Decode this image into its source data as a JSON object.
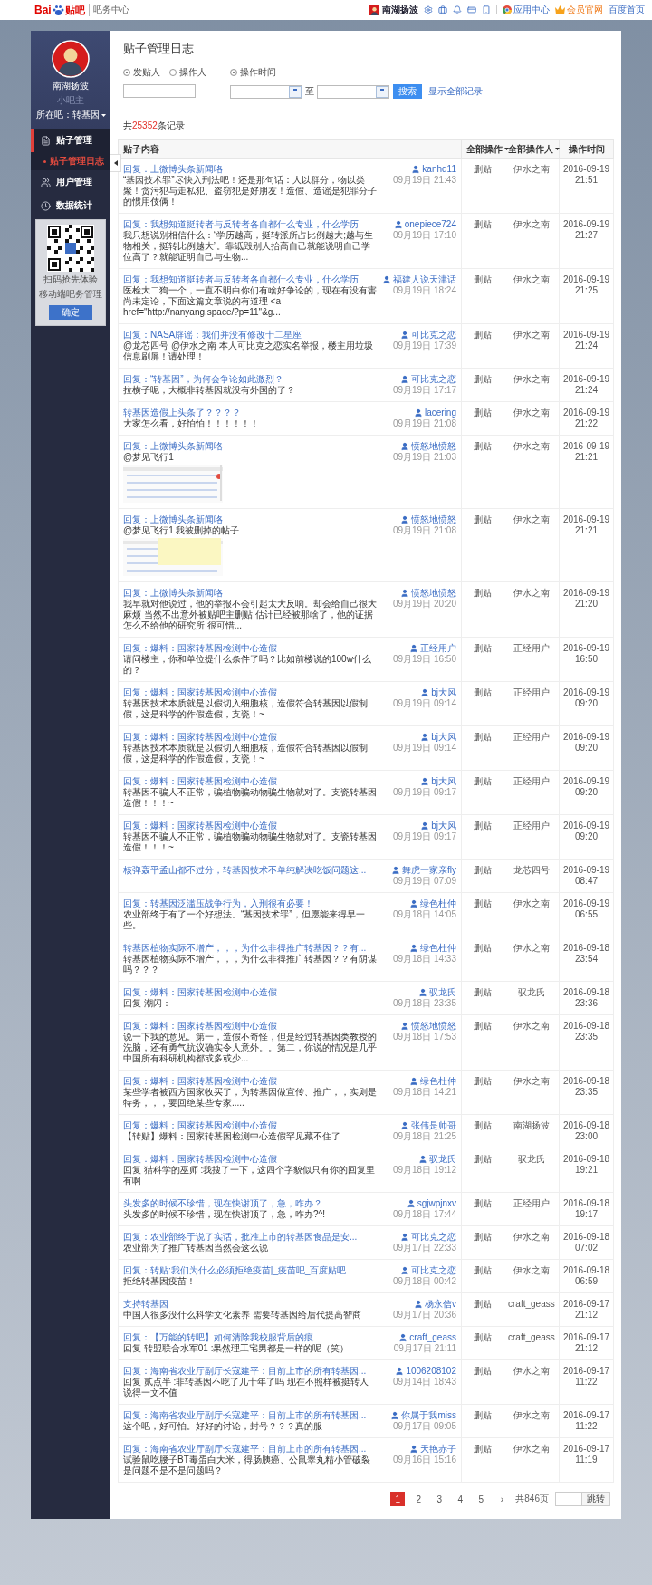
{
  "header": {
    "logo": {
      "latin": "Bai",
      "brand": "贴吧"
    },
    "product": "吧务中心",
    "user": "南湖扬波",
    "links": [
      {
        "label": "应用中心",
        "kind": "apps"
      },
      {
        "label": "会员官网",
        "kind": "vip"
      },
      {
        "label": "百度首页",
        "kind": "plain"
      }
    ]
  },
  "sidebar": {
    "profile": {
      "name": "南湖扬波",
      "role": "小吧主",
      "forum": "所在吧：转基因"
    },
    "menu": [
      {
        "label": "贴子管理",
        "kind": "posts",
        "selected": true,
        "children": [
          {
            "label": "贴子管理日志",
            "selected": true
          }
        ]
      },
      {
        "label": "用户管理",
        "kind": "users",
        "selected": false
      },
      {
        "label": "数据统计",
        "kind": "stats",
        "selected": false
      }
    ],
    "qr_popup": {
      "lines": [
        "扫码抢先体验",
        "移动端吧务管理"
      ],
      "button": "确定"
    }
  },
  "page": {
    "title": "贴子管理日志",
    "filters": {
      "by": [
        {
          "label": "发贴人",
          "selected": true
        },
        {
          "label": "操作人",
          "selected": false
        }
      ],
      "time": {
        "label": "操作时间",
        "selected": true
      },
      "separator": "至",
      "search_button": "搜索",
      "show_all": "显示全部记录"
    },
    "record_count": {
      "prefix": "共",
      "count": "25352",
      "suffix": "条记录"
    }
  },
  "table": {
    "columns": [
      {
        "label": "贴子内容",
        "dropdown": false
      },
      {
        "label": "全部操作",
        "dropdown": true
      },
      {
        "label": "全部操作人",
        "dropdown": true
      },
      {
        "label": "操作时间",
        "dropdown": false
      }
    ],
    "rows": [
      {
        "kind": "text",
        "title": "回复：上微博头条新闻咯",
        "body": "“基因技术罪”尽快入刑法吧！还是那句话：人以群分，物以类聚！贪污犯与走私犯、盗窃犯是好朋友！造假、造谣是犯罪分子的惯用伎俩！",
        "author": "kanhd11",
        "posted": "09月19日 21:43",
        "action": "删贴",
        "operator": "伊水之南",
        "date": "2016-09-19",
        "time": "21:51"
      },
      {
        "kind": "text",
        "title": "回复：我想知道挺转者与反转者各自都什么专业，什么学历",
        "body": "我只想说别相信什么：“学历越高，挺转派所占比例越大;越与生物相关，挺转比例越大”。靠诋毁别人抬高自己就能说明自己学位高了？就能证明自己与生物...",
        "author": "onepiece724",
        "posted": "09月19日 17:10",
        "action": "删贴",
        "operator": "伊水之南",
        "date": "2016-09-19",
        "time": "21:27"
      },
      {
        "kind": "text",
        "title": "回复：我想知道挺转者与反转者各自都什么专业，什么学历",
        "body": "医检大二狗一个，一直不明白你们有啥好争论的，现在有没有害尚未定论，下面这篇文章说的有道理 <a href=\"http://nanyang.space/?p=11\"&g...",
        "author": "福建人说天津话",
        "posted": "09月19日 18:24",
        "action": "删贴",
        "operator": "伊水之南",
        "date": "2016-09-19",
        "time": "21:25"
      },
      {
        "kind": "text",
        "title": "回复：NASA辟谣：我们并没有修改十二星座",
        "body": "@龙芯四号 @伊水之南 本人可比克之恋实名举报，楼主用垃圾信息刷屏！请处理！",
        "author": "可比克之恋",
        "posted": "09月19日 17:39",
        "action": "删贴",
        "operator": "伊水之南",
        "date": "2016-09-19",
        "time": "21:24"
      },
      {
        "kind": "text",
        "title": "回复：“转基因”，为何会争论如此激烈？",
        "body": "拉横子呢，大概非转基因就没有外国的了？",
        "author": "可比克之恋",
        "posted": "09月19日 17:17",
        "action": "删贴",
        "operator": "伊水之南",
        "date": "2016-09-19",
        "time": "21:24"
      },
      {
        "kind": "text",
        "title": "转基因造假上头条了？？？？",
        "body": "大家怎么看，好怕怕！！！！！！",
        "author": "lacering",
        "posted": "09月19日 21:08",
        "action": "删贴",
        "operator": "伊水之南",
        "date": "2016-09-19",
        "time": "21:22"
      },
      {
        "title": "回复：上微博头条新闻咯",
        "body": "@梦见飞行1",
        "author": "愤怒地愤怒",
        "posted": "09月19日 21:03",
        "action": "删贴",
        "operator": "伊水之南",
        "date": "2016-09-19",
        "time": "21:21"
      },
      {
        "title": "回复：上微博头条新闻咯",
        "body": "@梦见飞行1 我被删掉的帖子",
        "author": "愤怒地愤怒",
        "posted": "09月19日 21:08",
        "action": "删贴",
        "operator": "伊水之南",
        "date": "2016-09-19",
        "time": "21:21"
      },
      {
        "kind": "text",
        "title": "回复：上微博头条新闻咯",
        "body": "我早就对他说过，他的举报不会引起太大反响。却会给自己很大麻烦 当然不出意外被贴吧主删贴 估计已经被那啥了，他的证据怎么不给他的研究所 很可惜...",
        "author": "愤怒地愤怒",
        "posted": "09月19日 20:20",
        "action": "删贴",
        "operator": "伊水之南",
        "date": "2016-09-19",
        "time": "21:20"
      },
      {
        "kind": "text",
        "title": "回复：爆料：国家转基因检测中心造假",
        "body": "请问楼主，你和单位提什么条件了吗？比如前楼说的100w什么的？",
        "author": "正经用户",
        "posted": "09月19日 16:50",
        "action": "删贴",
        "operator": "正经用户",
        "date": "2016-09-19",
        "time": "16:50"
      },
      {
        "kind": "text",
        "title": "回复：爆料：国家转基因检测中心造假",
        "body": "转基因技术本质就是以假切入细胞核，造假符合转基因以假制假，这是科学的作假造假，支瓷！~",
        "author": "bj大风",
        "posted": "09月19日 09:14",
        "action": "删贴",
        "operator": "正经用户",
        "date": "2016-09-19",
        "time": "09:20"
      },
      {
        "kind": "text",
        "title": "回复：爆料：国家转基因检测中心造假",
        "body": "转基因技术本质就是以假切入细胞核，造假符合转基因以假制假，这是科学的作假造假，支瓷！~",
        "author": "bj大风",
        "posted": "09月19日 09:14",
        "action": "删贴",
        "operator": "正经用户",
        "date": "2016-09-19",
        "time": "09:20"
      },
      {
        "kind": "text",
        "title": "回复：爆料：国家转基因检测中心造假",
        "body": "转基因不骗人不正常，骗植物骗动物骗生物就对了。支瓷转基因造假！！！~",
        "author": "bj大风",
        "posted": "09月19日 09:17",
        "action": "删贴",
        "operator": "正经用户",
        "date": "2016-09-19",
        "time": "09:20"
      },
      {
        "kind": "text",
        "title": "回复：爆料：国家转基因检测中心造假",
        "body": "转基因不骗人不正常，骗植物骗动物骗生物就对了。支瓷转基因造假！！！~",
        "author": "bj大风",
        "posted": "09月19日 09:17",
        "action": "删贴",
        "operator": "正经用户",
        "date": "2016-09-19",
        "time": "09:20"
      },
      {
        "kind": "text",
        "title": "核弹轰平孟山都不过分，转基因技术不单纯解决吃饭问题这...",
        "author": "舞虎一家亲fly",
        "posted": "09月19日 07:09",
        "action": "删贴",
        "operator": "龙芯四号",
        "date": "2016-09-19",
        "time": "08:47"
      },
      {
        "kind": "text",
        "title": "回复：转基因泛滥压战争行为，入刑很有必要！",
        "body": "农业部终于有了一个好想法。“基因技术罪”，但愿能来得早一些。",
        "author": "绿色杜仲",
        "posted": "09月18日 14:05",
        "action": "删贴",
        "operator": "伊水之南",
        "date": "2016-09-19",
        "time": "06:55"
      },
      {
        "kind": "text",
        "title": "转基因植物实际不增产，，，为什么非得推广转基因？？有...",
        "body": "转基因植物实际不增产，，，为什么非得推广转基因？？有阴谋吗？？？",
        "author": "绿色杜仲",
        "posted": "09月18日 14:33",
        "action": "删贴",
        "operator": "伊水之南",
        "date": "2016-09-18",
        "time": "23:54"
      },
      {
        "kind": "text",
        "title": "回复：爆料：国家转基因检测中心造假",
        "body": "回复 潮闪：",
        "author": "驭龙氏",
        "posted": "09月18日 23:35",
        "action": "删贴",
        "operator": "驭龙氏",
        "date": "2016-09-18",
        "time": "23:36"
      },
      {
        "kind": "text",
        "title": "回复：爆料：国家转基因检测中心造假",
        "body": "说一下我的意见。第一，造假不奇怪，但是经过转基因类教授的洗脑，还有勇气抗议确实令人意外。。第二，你说的情况是几乎中国所有科研机构都或多或少...",
        "author": "愤怒地愤怒",
        "posted": "09月18日 17:53",
        "action": "删贴",
        "operator": "伊水之南",
        "date": "2016-09-18",
        "time": "23:35"
      },
      {
        "kind": "text",
        "title": "回复：爆料：国家转基因检测中心造假",
        "body": "某些学者被西方国家收买了，为转基因做宣传、推广，，实则是特务，，，要回绝某些专家.....",
        "author": "绿色杜仲",
        "posted": "09月18日 14:21",
        "action": "删贴",
        "operator": "伊水之南",
        "date": "2016-09-18",
        "time": "23:35"
      },
      {
        "kind": "text",
        "title": "回复：爆料：国家转基因检测中心造假",
        "body": "【转贴】爆料：国家转基因检测中心造假罕见藏不住了",
        "author": "张伟是帅哥",
        "posted": "09月18日 21:25",
        "action": "删贴",
        "operator": "南湖扬波",
        "date": "2016-09-18",
        "time": "23:00"
      },
      {
        "kind": "text",
        "title": "回复：爆料：国家转基因检测中心造假",
        "body": "回复 猎科学的巫师 :我搜了一下，这四个字貌似只有你的回复里有啊",
        "author": "驭龙氏",
        "posted": "09月18日 19:12",
        "action": "删贴",
        "operator": "驭龙氏",
        "date": "2016-09-18",
        "time": "19:21"
      },
      {
        "kind": "text",
        "title": "头发多的时候不珍惜，现在快谢顶了，急，咋办？",
        "body": "头发多的时候不珍惜，现在快谢顶了，急，咋办?^!",
        "author": "sgjwpjnxv",
        "posted": "09月18日 17:44",
        "action": "删贴",
        "operator": "正经用户",
        "date": "2016-09-18",
        "time": "19:17"
      },
      {
        "kind": "text",
        "title": "回复：农业部终于说了实话，批准上市的转基因食品是安...",
        "body": "农业部为了推广转基因当然会这么说",
        "author": "可比克之恋",
        "posted": "09月17日 22:33",
        "action": "删贴",
        "operator": "伊水之南",
        "date": "2016-09-18",
        "time": "07:02"
      },
      {
        "kind": "text",
        "title": "回复：转贴:我们为什么必须拒绝疫苗|_疫苗吧_百度贴吧",
        "body": "拒绝转基因疫苗！",
        "author": "可比克之恋",
        "posted": "09月18日 00:42",
        "action": "删贴",
        "operator": "伊水之南",
        "date": "2016-09-18",
        "time": "06:59"
      },
      {
        "kind": "text",
        "title": "支持转基因",
        "body": "中国人很多没什么科学文化素养 需要转基因给后代提高智商",
        "author": "杨永信v",
        "posted": "09月17日 20:36",
        "action": "删贴",
        "operator": "craft_geass",
        "date": "2016-09-17",
        "time": "21:12"
      },
      {
        "kind": "text",
        "title": "回复：【万能的转吧】如何清除我校服背后的痕",
        "body": "回复 转盟联合水军01 :果然理工宅男都是一样的呢（笑）",
        "author": "craft_geass",
        "posted": "09月17日 21:11",
        "action": "删贴",
        "operator": "craft_geass",
        "date": "2016-09-17",
        "time": "21:12"
      },
      {
        "kind": "text",
        "title": "回复：海南省农业厅副厅长寇建平：目前上市的所有转基因...",
        "body": "回复 贰点半 :非转基因不吃了几十年了吗 现在不照样被挺转人说得一文不值",
        "author": "1006208102",
        "posted": "09月14日 18:43",
        "action": "删贴",
        "operator": "伊水之南",
        "date": "2016-09-17",
        "time": "11:22"
      },
      {
        "kind": "text",
        "title": "回复：海南省农业厅副厅长寇建平：目前上市的所有转基因...",
        "body": "这个吧，好可怕。好好的讨论，封号？？？真的服",
        "author": "你属于我miss",
        "posted": "09月17日 09:05",
        "action": "删贴",
        "operator": "伊水之南",
        "date": "2016-09-17",
        "time": "11:22"
      },
      {
        "kind": "text",
        "title": "回复：海南省农业厅副厅长寇建平：目前上市的所有转基因...",
        "body": "试验鼠吃腰子BT毒蛋白大米，得肠胰癌、公鼠睾丸精小管破裂是问题不是不是问题吗？",
        "author": "天艳赤子",
        "posted": "09月16日 15:16",
        "action": "删贴",
        "operator": "伊水之南",
        "date": "2016-09-17",
        "time": "11:19"
      }
    ]
  },
  "pagination": {
    "pages": [
      {
        "label": "1",
        "selected": true
      },
      {
        "label": "2",
        "selected": false
      },
      {
        "label": "3",
        "selected": false
      },
      {
        "label": "4",
        "selected": false
      },
      {
        "label": "5",
        "selected": false
      }
    ],
    "next": "›",
    "total": "共846页",
    "jump_button": "跳转"
  }
}
